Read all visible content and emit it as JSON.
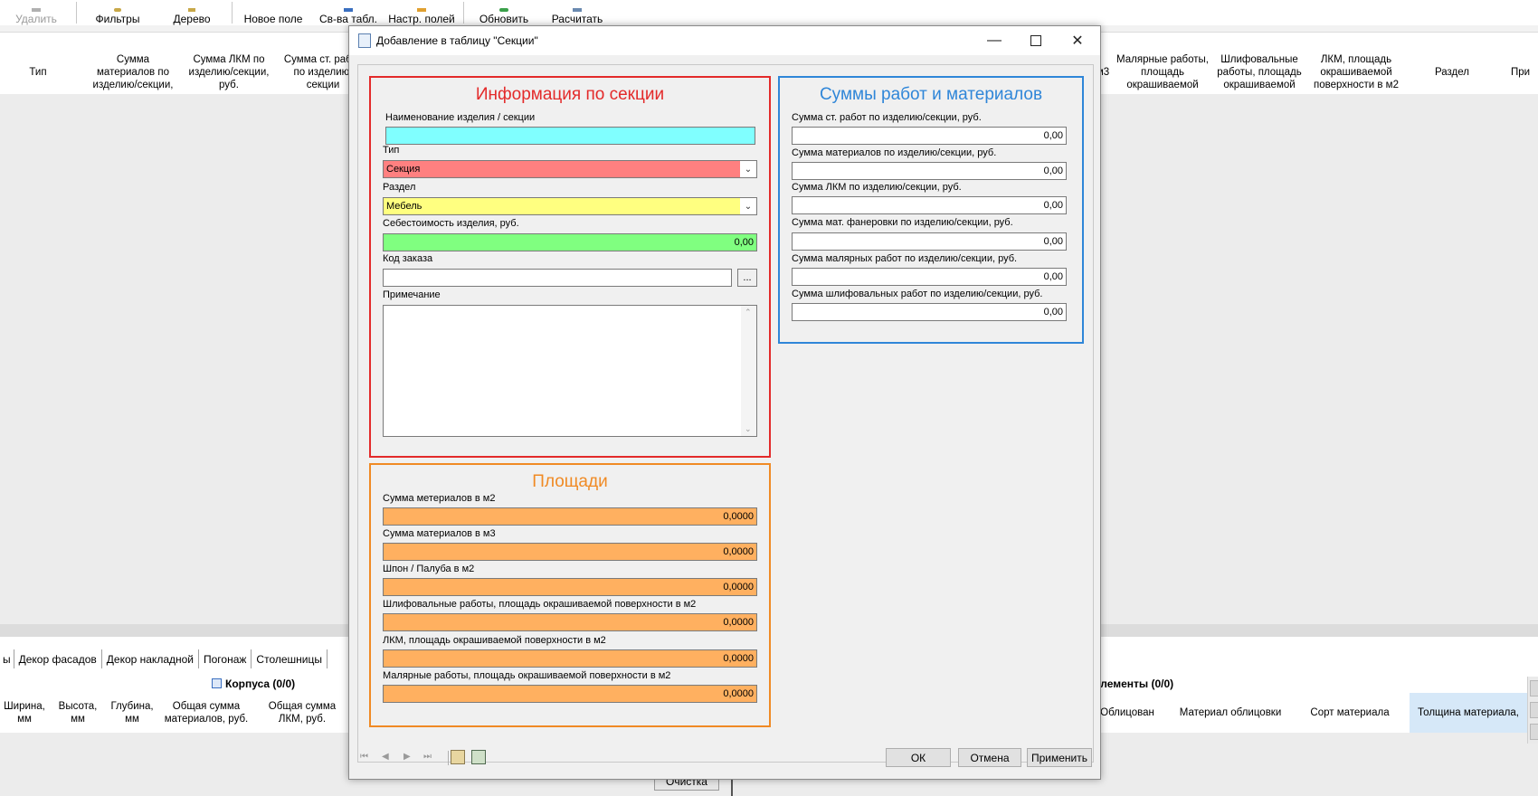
{
  "toolbar": {
    "delete": "Удалить",
    "filters": "Фильтры",
    "tree": "Дерево",
    "new_field": "Новое поле",
    "table_props": "Св-ва табл.",
    "field_settings": "Настр. полей",
    "refresh": "Обновить",
    "calculate": "Расчитать"
  },
  "grid_header": {
    "type": "Тип",
    "mat_sum": "Сумма материалов по изделию/секции,",
    "lkm_sum": "Сумма ЛКМ по изделию/секции, руб.",
    "st_sum": "Сумма ст. работ по изделию/секции",
    "m3": "м3",
    "paint_area": "Малярные работы, площадь окрашиваемой",
    "grind_area": "Шлифовальные работы, площадь окрашиваемой",
    "lkm_area": "ЛКМ, площадь окрашиваемой поверхности в м2",
    "section": "Раздел",
    "note_trunc": "При"
  },
  "tabs": [
    "ы",
    "Декор фасадов",
    "Декор накладной",
    "Погонаж",
    "Столешницы"
  ],
  "lower": {
    "korpusa_title": "Корпуса (0/0)",
    "elements_title": "Элементы (0/0)",
    "cols_left": [
      "Ширина, мм",
      "Высота, мм",
      "Глубина, мм",
      "Общая сумма материалов, руб.",
      "Общая сумма ЛКМ, руб."
    ],
    "cols_right": [
      "Облицован",
      "Материал облицовки",
      "Сорт материала",
      "Толщина материала,"
    ],
    "clear_btn": "Очистка"
  },
  "dialog": {
    "title": "Добавление в таблицу \"Секции\"",
    "info": {
      "title": "Информация по секции",
      "name_label": "Наименование изделия / секции",
      "name_value": "",
      "type_label": "Тип",
      "type_value": "Секция",
      "section_label": "Раздел",
      "section_value": "Мебель",
      "cost_label": "Себестоимость изделия, руб.",
      "cost_value": "0,00",
      "order_label": "Код заказа",
      "order_value": "",
      "order_btn": "...",
      "note_label": "Примечание"
    },
    "sums": {
      "title": "Суммы работ и материалов",
      "rows": [
        {
          "label": "Сумма ст. работ по изделию/секции, руб.",
          "value": "0,00"
        },
        {
          "label": "Сумма материалов по изделию/секции, руб.",
          "value": "0,00"
        },
        {
          "label": "Сумма ЛКМ по изделию/секции, руб.",
          "value": "0,00"
        },
        {
          "label": "Сумма мат. фанеровки по изделию/секции, руб.",
          "value": "0,00"
        },
        {
          "label": "Сумма малярных работ по изделию/секции, руб.",
          "value": "0,00"
        },
        {
          "label": "Сумма шлифовальных работ по изделию/секции, руб.",
          "value": "0,00"
        }
      ]
    },
    "areas": {
      "title": "Площади",
      "rows": [
        {
          "label": "Сумма метериалов в м2",
          "value": "0,0000"
        },
        {
          "label": "Сумма материалов в м3",
          "value": "0,0000"
        },
        {
          "label": "Шпон / Палуба в м2",
          "value": "0,0000"
        },
        {
          "label": "Шлифовальные работы, площадь окрашиваемой поверхности в м2",
          "value": "0,0000"
        },
        {
          "label": "ЛКМ, площадь окрашиваемой поверхности в м2",
          "value": "0,0000"
        },
        {
          "label": "Малярные работы, площадь окрашиваемой поверхности в м2",
          "value": "0,0000"
        }
      ]
    },
    "buttons": {
      "ok": "ОК",
      "cancel": "Отмена",
      "apply": "Применить"
    }
  },
  "colors": {
    "info_border": "#e32a2a",
    "sums_border": "#2f86d8",
    "areas_border": "#f08a24",
    "name_fill": "#80ffff",
    "type_fill": "#ff8080",
    "section_fill": "#ffff80",
    "cost_fill": "#80ff80",
    "area_fill": "#ffb060"
  }
}
